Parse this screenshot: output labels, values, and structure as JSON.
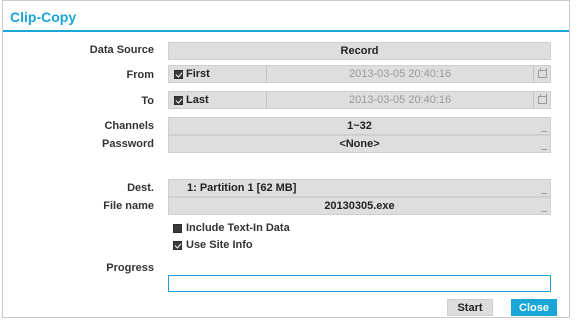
{
  "dialog": {
    "title": "Clip-Copy"
  },
  "form": {
    "data_source": {
      "label": "Data Source",
      "value": "Record"
    },
    "from": {
      "label": "From",
      "check_label": "First",
      "checked": true,
      "datetime": "2013-03-05  20:40:16",
      "icon": "calendar-icon"
    },
    "to": {
      "label": "To",
      "check_label": "Last",
      "checked": true,
      "datetime": "2013-03-05  20:40:16",
      "icon": "calendar-icon"
    },
    "channels": {
      "label": "Channels",
      "value": "1~32"
    },
    "password": {
      "label": "Password",
      "value": "<None>"
    },
    "dest": {
      "label": "Dest.",
      "value": "1: Partition 1 [62 MB]"
    },
    "file_name": {
      "label": "File name",
      "value": "20130305.exe"
    },
    "options": [
      {
        "label": "Include Text-In Data",
        "checked": false
      },
      {
        "label": "Use Site Info",
        "checked": true
      }
    ],
    "progress": {
      "label": "Progress",
      "value": 0
    }
  },
  "buttons": {
    "start": "Start",
    "close": "Close"
  },
  "colors": {
    "accent": "#1aa6d6",
    "field_bg": "#dedede"
  }
}
